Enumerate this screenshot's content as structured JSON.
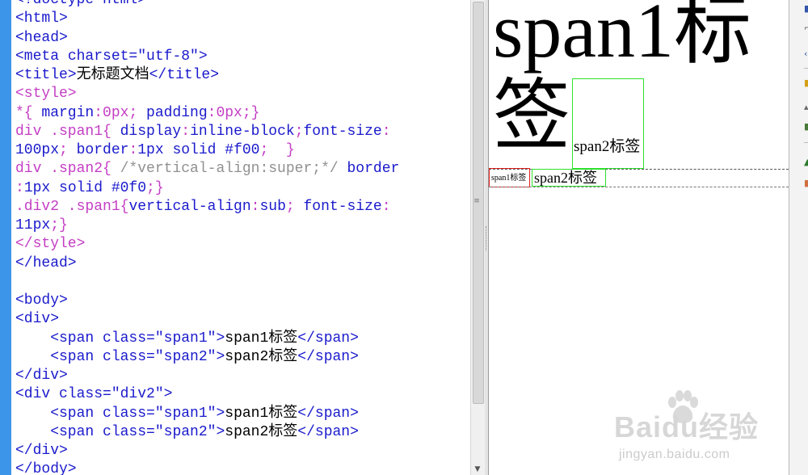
{
  "editor": {
    "lines": [
      [
        {
          "t": "<!doctype html>",
          "c": "c-tag"
        }
      ],
      [
        {
          "t": "<html>",
          "c": "c-tag"
        }
      ],
      [
        {
          "t": "<head>",
          "c": "c-tag"
        }
      ],
      [
        {
          "t": "<meta ",
          "c": "c-tag"
        },
        {
          "t": "charset=",
          "c": "c-attr"
        },
        {
          "t": "\"utf-8\"",
          "c": "c-str"
        },
        {
          "t": ">",
          "c": "c-tag"
        }
      ],
      [
        {
          "t": "<title>",
          "c": "c-tag"
        },
        {
          "t": "无标题文档",
          "c": "c-txt"
        },
        {
          "t": "</title>",
          "c": "c-tag"
        }
      ],
      [
        {
          "t": "<style>",
          "c": "c-sel"
        }
      ],
      [
        {
          "t": "*{ ",
          "c": "c-sel"
        },
        {
          "t": "margin",
          "c": "c-prop"
        },
        {
          "t": ":0px; ",
          "c": "c-punc"
        },
        {
          "t": "padding",
          "c": "c-prop"
        },
        {
          "t": ":0px;}",
          "c": "c-punc"
        }
      ],
      [
        {
          "t": "div .span1{ ",
          "c": "c-sel"
        },
        {
          "t": "display",
          "c": "c-prop"
        },
        {
          "t": ":",
          "c": "c-punc"
        },
        {
          "t": "inline-block",
          "c": "c-prop"
        },
        {
          "t": ";",
          "c": "c-punc"
        },
        {
          "t": "font-size",
          "c": "c-prop"
        },
        {
          "t": ":",
          "c": "c-punc"
        }
      ],
      [
        {
          "t": "100px",
          "c": "c-prop"
        },
        {
          "t": "; ",
          "c": "c-punc"
        },
        {
          "t": "border",
          "c": "c-prop"
        },
        {
          "t": ":",
          "c": "c-punc"
        },
        {
          "t": "1px solid #f00",
          "c": "c-prop"
        },
        {
          "t": ";  }",
          "c": "c-punc"
        }
      ],
      [
        {
          "t": "div .span2{ ",
          "c": "c-sel"
        },
        {
          "t": "/*vertical-align:super;*/ ",
          "c": "c-cmt"
        },
        {
          "t": "border",
          "c": "c-prop"
        }
      ],
      [
        {
          "t": ":",
          "c": "c-punc"
        },
        {
          "t": "1px solid #0f0",
          "c": "c-prop"
        },
        {
          "t": ";}",
          "c": "c-punc"
        }
      ],
      [
        {
          "t": ".div2 .span1{",
          "c": "c-sel"
        },
        {
          "t": "vertical-align",
          "c": "c-prop"
        },
        {
          "t": ":",
          "c": "c-punc"
        },
        {
          "t": "sub",
          "c": "c-prop"
        },
        {
          "t": "; ",
          "c": "c-punc"
        },
        {
          "t": "font-size",
          "c": "c-prop"
        },
        {
          "t": ":",
          "c": "c-punc"
        }
      ],
      [
        {
          "t": "11px",
          "c": "c-prop"
        },
        {
          "t": ";}",
          "c": "c-punc"
        }
      ],
      [
        {
          "t": "</style>",
          "c": "c-sel"
        }
      ],
      [
        {
          "t": "</head>",
          "c": "c-tag"
        }
      ],
      [
        {
          "t": "",
          "c": "c-txt"
        }
      ],
      [
        {
          "t": "<body>",
          "c": "c-tag"
        }
      ],
      [
        {
          "t": "<div>",
          "c": "c-tag"
        }
      ],
      [
        {
          "t": "    <span ",
          "c": "c-tag"
        },
        {
          "t": "class=",
          "c": "c-attr"
        },
        {
          "t": "\"span1\"",
          "c": "c-str"
        },
        {
          "t": ">",
          "c": "c-tag"
        },
        {
          "t": "span1标签",
          "c": "c-txt"
        },
        {
          "t": "</span>",
          "c": "c-tag"
        }
      ],
      [
        {
          "t": "    <span ",
          "c": "c-tag"
        },
        {
          "t": "class=",
          "c": "c-attr"
        },
        {
          "t": "\"span2\"",
          "c": "c-str"
        },
        {
          "t": ">",
          "c": "c-tag"
        },
        {
          "t": "span2标签",
          "c": "c-txt"
        },
        {
          "t": "</span>",
          "c": "c-tag"
        }
      ],
      [
        {
          "t": "</div>",
          "c": "c-tag"
        }
      ],
      [
        {
          "t": "<div ",
          "c": "c-tag"
        },
        {
          "t": "class=",
          "c": "c-attr"
        },
        {
          "t": "\"div2\"",
          "c": "c-str"
        },
        {
          "t": ">",
          "c": "c-tag"
        }
      ],
      [
        {
          "t": "    <span ",
          "c": "c-tag"
        },
        {
          "t": "class=",
          "c": "c-attr"
        },
        {
          "t": "\"span1\"",
          "c": "c-str"
        },
        {
          "t": ">",
          "c": "c-tag"
        },
        {
          "t": "span1标签",
          "c": "c-txt"
        },
        {
          "t": "</span>",
          "c": "c-tag"
        }
      ],
      [
        {
          "t": "    <span ",
          "c": "c-tag"
        },
        {
          "t": "class=",
          "c": "c-attr"
        },
        {
          "t": "\"span2\"",
          "c": "c-str"
        },
        {
          "t": ">",
          "c": "c-tag"
        },
        {
          "t": "span2标签",
          "c": "c-txt"
        },
        {
          "t": "</span>",
          "c": "c-tag"
        }
      ],
      [
        {
          "t": "</div>",
          "c": "c-tag"
        }
      ],
      [
        {
          "t": "</body>",
          "c": "c-tag"
        }
      ]
    ]
  },
  "preview": {
    "div1_span1_line1": "span1标",
    "div1_span1_line2": "签",
    "div1_span2": "span2标签",
    "div2_span1": "span1标签",
    "div2_span2": "span2标签"
  },
  "watermark": {
    "brand": "Baidu经验",
    "domain": "jingyan.baidu.com"
  },
  "colors": {
    "gutter": "#3d95ea",
    "tag": "#1a1acc",
    "css_selector": "#c43ec4",
    "comment": "#909090",
    "red_border": "#e02020",
    "green_border": "#2ee02e"
  },
  "icons": {
    "scroll_down": "down-arrow-icon",
    "scroll_grip": "grip-icon"
  }
}
